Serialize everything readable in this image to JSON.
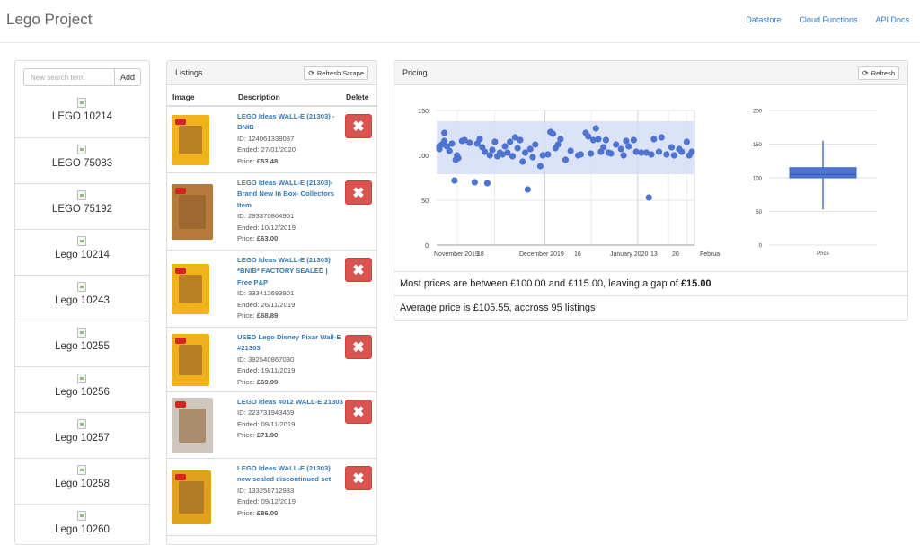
{
  "app": {
    "title": "Lego Project"
  },
  "nav": [
    "Datastore",
    "Cloud Functions",
    "API Docs"
  ],
  "sidebar": {
    "search_placeholder": "New search term",
    "add_label": "Add",
    "sets": [
      "LEGO 10214",
      "LEGO 75083",
      "LEGO 75192",
      "Lego 10214",
      "Lego 10243",
      "Lego 10255",
      "Lego 10256",
      "Lego 10257",
      "Lego 10258",
      "Lego 10260"
    ]
  },
  "listings": {
    "title": "Listings",
    "refresh_label": "Refresh Scrape",
    "columns": {
      "image": "Image",
      "description": "Description",
      "delete": "Delete"
    },
    "delete_glyph": "✖",
    "rows": [
      {
        "title": "LEGO Ideas WALL-E (21303) - BNIB",
        "id": "ID: 124061338087",
        "ended": "Ended: 27/01/2020",
        "price_label": "Price: ",
        "price": "£53.48"
      },
      {
        "title": "LEGO Ideas WALL-E (21303)- Brand New In Box- Collectors Item",
        "id": "ID: 293370864961",
        "ended": "Ended: 10/12/2019",
        "price_label": "Price: ",
        "price": "£63.00"
      },
      {
        "title": "LEGO Ideas WALL-E (21303) *BNIB* FACTORY SEALED | Free P&P",
        "id": "ID: 333412693901",
        "ended": "Ended: 26/11/2019",
        "price_label": "Price: ",
        "price": "£68.89"
      },
      {
        "title": "USED Lego Disney Pixar Wall-E #21303",
        "id": "ID: 392540867030",
        "ended": "Ended: 19/11/2019",
        "price_label": "Price: ",
        "price": "£69.99"
      },
      {
        "title": "LEGO Ideas #012 WALL-E 21303",
        "id": "ID: 223731943469",
        "ended": "Ended: 09/11/2019",
        "price_label": "Price: ",
        "price": "£71.90"
      },
      {
        "title": "LEGO Ideas WALL-E (21303) new sealed discontinued set",
        "id": "ID: 133258712983",
        "ended": "Ended: 09/12/2019",
        "price_label": "Price: ",
        "price": "£86.00"
      }
    ]
  },
  "pricing": {
    "title": "Pricing",
    "refresh_label": "Refresh",
    "stat1_prefix": "Most prices are between £100.00 and £115.00, leaving a gap of ",
    "stat1_gap": "£15.00",
    "stat2": "Average price is £105.55, accross 95 listings"
  },
  "chart_data": [
    {
      "type": "scatter",
      "x_ticks": [
        "November 2019",
        "18",
        "December 2019",
        "16",
        "January 2020",
        "13",
        "20",
        "February 2020"
      ],
      "y_ticks": [
        0,
        50,
        100,
        150
      ],
      "ylim": [
        0,
        150
      ],
      "band": [
        79,
        138
      ],
      "points_approx": [
        [
          0,
          110
        ],
        [
          0,
          107
        ],
        [
          0.01,
          112
        ],
        [
          0.02,
          125
        ],
        [
          0.02,
          116
        ],
        [
          0.03,
          110
        ],
        [
          0.04,
          105
        ],
        [
          0.05,
          113
        ],
        [
          0.06,
          72
        ],
        [
          0.065,
          95
        ],
        [
          0.07,
          100
        ],
        [
          0.075,
          97
        ],
        [
          0.09,
          116
        ],
        [
          0.1,
          117
        ],
        [
          0.12,
          114
        ],
        [
          0.14,
          70
        ],
        [
          0.15,
          113
        ],
        [
          0.16,
          118
        ],
        [
          0.17,
          109
        ],
        [
          0.18,
          104
        ],
        [
          0.19,
          69
        ],
        [
          0.2,
          100
        ],
        [
          0.21,
          106
        ],
        [
          0.22,
          115
        ],
        [
          0.23,
          99
        ],
        [
          0.24,
          103
        ],
        [
          0.25,
          101
        ],
        [
          0.26,
          110
        ],
        [
          0.27,
          103
        ],
        [
          0.28,
          115
        ],
        [
          0.29,
          99
        ],
        [
          0.3,
          120
        ],
        [
          0.31,
          108
        ],
        [
          0.32,
          117
        ],
        [
          0.33,
          93
        ],
        [
          0.34,
          103
        ],
        [
          0.35,
          62
        ],
        [
          0.36,
          107
        ],
        [
          0.37,
          98
        ],
        [
          0.38,
          112
        ],
        [
          0.4,
          88
        ],
        [
          0.41,
          100
        ],
        [
          0.43,
          101
        ],
        [
          0.44,
          126
        ],
        [
          0.45,
          124
        ],
        [
          0.46,
          108
        ],
        [
          0.47,
          112
        ],
        [
          0.48,
          118
        ],
        [
          0.5,
          95
        ],
        [
          0.52,
          105
        ],
        [
          0.55,
          100
        ],
        [
          0.56,
          101
        ],
        [
          0.58,
          125
        ],
        [
          0.59,
          121
        ],
        [
          0.6,
          102
        ],
        [
          0.61,
          117
        ],
        [
          0.62,
          130
        ],
        [
          0.63,
          118
        ],
        [
          0.64,
          104
        ],
        [
          0.65,
          109
        ],
        [
          0.66,
          117
        ],
        [
          0.67,
          103
        ],
        [
          0.68,
          102
        ],
        [
          0.7,
          112
        ],
        [
          0.72,
          107
        ],
        [
          0.73,
          100
        ],
        [
          0.74,
          116
        ],
        [
          0.75,
          110
        ],
        [
          0.77,
          117
        ],
        [
          0.78,
          104
        ],
        [
          0.8,
          103
        ],
        [
          0.82,
          103
        ],
        [
          0.83,
          53
        ],
        [
          0.84,
          101
        ],
        [
          0.85,
          118
        ],
        [
          0.87,
          104
        ],
        [
          0.88,
          120
        ],
        [
          0.9,
          101
        ],
        [
          0.92,
          109
        ],
        [
          0.93,
          100
        ],
        [
          0.95,
          107
        ],
        [
          0.96,
          104
        ],
        [
          0.98,
          115
        ],
        [
          0.99,
          100
        ],
        [
          1,
          104
        ]
      ]
    },
    {
      "type": "boxplot",
      "category": "Price",
      "y_ticks": [
        0,
        50,
        100,
        150,
        200
      ],
      "ylim": [
        0,
        200
      ],
      "whisker_low": 53,
      "q1": 100,
      "median": 105,
      "q3": 115,
      "whisker_high": 155
    }
  ],
  "colors": {
    "accent": "#337ab7",
    "danger": "#d9534f",
    "point": "#4e73d0",
    "band": "#d6ddf6"
  }
}
